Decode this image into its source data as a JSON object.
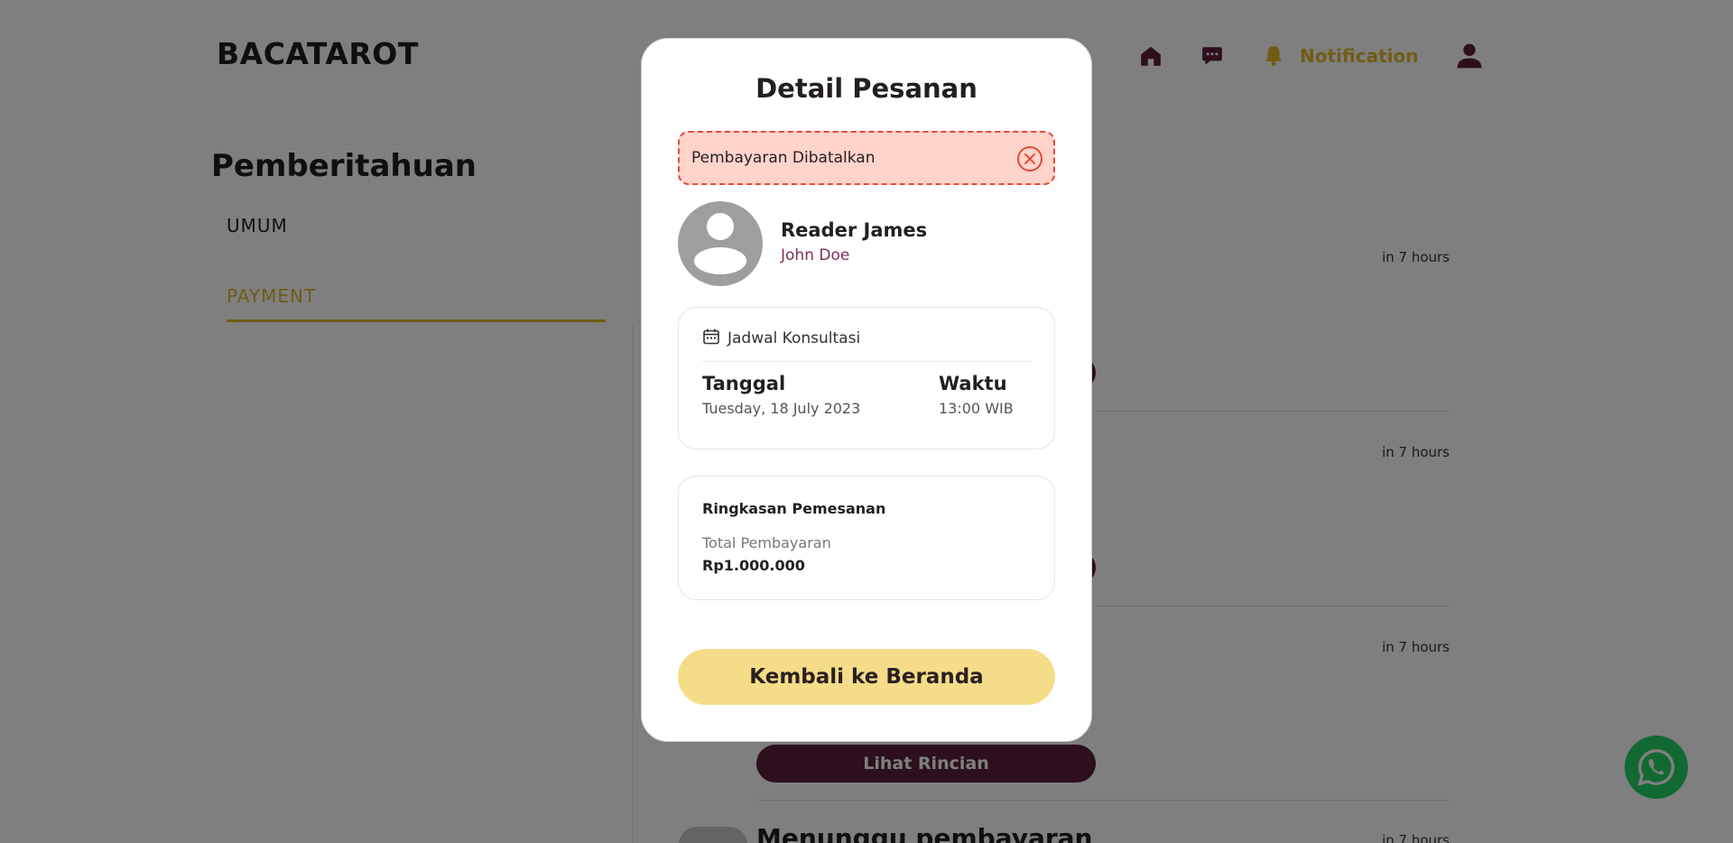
{
  "app": {
    "logo": "BACATAROT"
  },
  "nav": {
    "notification_label": "Notification",
    "icons": [
      "home-icon",
      "chat-icon",
      "bell-icon",
      "profile-icon"
    ]
  },
  "sidebar": {
    "title": "Pemberitahuan",
    "tabs": [
      {
        "label": "UMUM",
        "active": false
      },
      {
        "label": "PAYMENT",
        "active": true
      }
    ]
  },
  "feed": {
    "times": [
      "in 7 hours",
      "in 7 hours",
      "in 7 hours",
      "in 7 hours"
    ],
    "button_label": "Lihat Rincian",
    "last_item_title": "Menunggu pembayaran"
  },
  "modal": {
    "title": "Detail Pesanan",
    "status": {
      "text": "Pembayaran Dibatalkan",
      "color": "#e44a3a"
    },
    "reader": {
      "name": "Reader James",
      "client": "John Doe"
    },
    "schedule": {
      "heading": "Jadwal Konsultasi",
      "date_label": "Tanggal",
      "date_value": "Tuesday, 18 July 2023",
      "time_label": "Waktu",
      "time_value": "13:00 WIB"
    },
    "summary": {
      "heading": "Ringkasan Pemesanan",
      "total_label": "Total Pembayaran",
      "total_value": "Rp1.000.000"
    },
    "back_button": "Kembali ke Beranda"
  },
  "colors": {
    "brand_dark": "#5a1f3a",
    "accent_gold": "#e0b92a",
    "button_yellow": "#f5dc88",
    "whatsapp_green": "#25d366"
  }
}
